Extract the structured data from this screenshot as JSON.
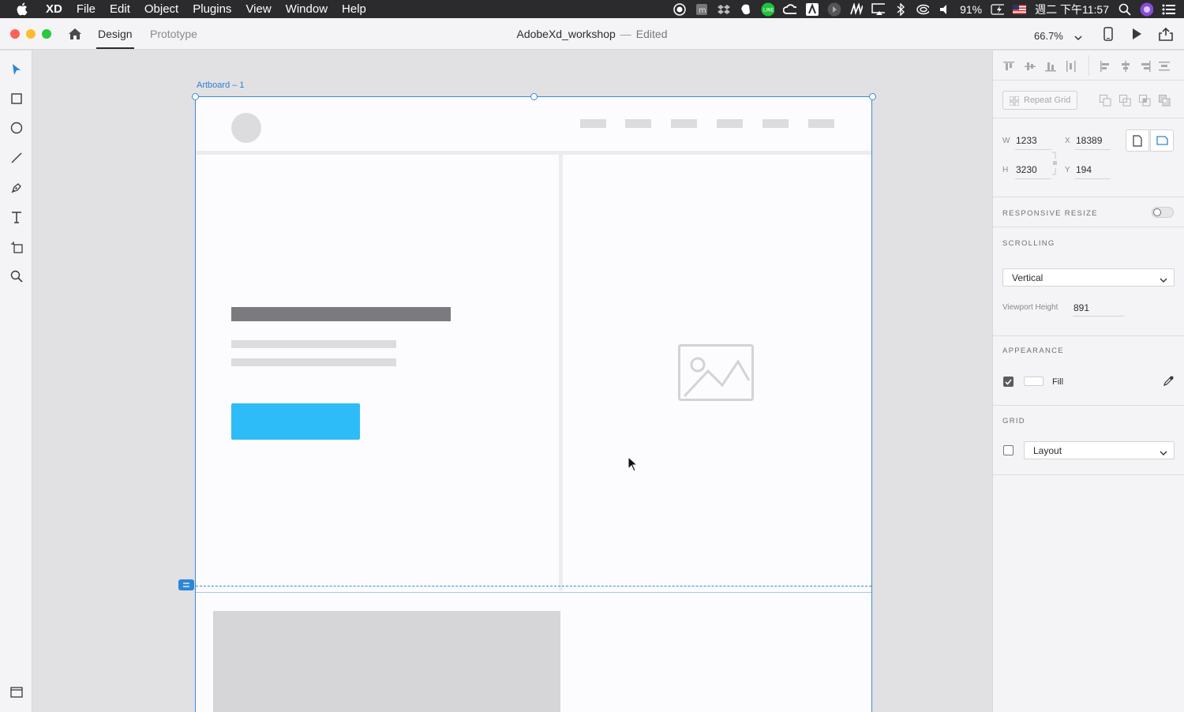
{
  "menubar": {
    "app": "XD",
    "items": [
      "File",
      "Edit",
      "Object",
      "Plugins",
      "View",
      "Window",
      "Help"
    ],
    "battery": "91%",
    "clock": "週二 下午11:57"
  },
  "toolbar": {
    "tab_design": "Design",
    "tab_prototype": "Prototype",
    "doc_name": "AdobeXd_workshop",
    "separator": "—",
    "doc_status": "Edited",
    "zoom": "66.7%"
  },
  "canvas": {
    "artboard_label": "Artboard – 1"
  },
  "panel": {
    "repeat_grid": "Repeat Grid",
    "w_label": "W",
    "w_value": "1233",
    "h_label": "H",
    "h_value": "3230",
    "x_label": "X",
    "x_value": "18389",
    "y_label": "Y",
    "y_value": "194",
    "responsive_resize": "RESPONSIVE RESIZE",
    "scrolling": "SCROLLING",
    "scrolling_value": "Vertical",
    "viewport_label": "Viewport Height",
    "viewport_value": "891",
    "appearance": "APPEARANCE",
    "fill_label": "Fill",
    "fill_checked": true,
    "grid": "GRID",
    "grid_value": "Layout",
    "grid_checked": false
  },
  "colors": {
    "accent": "#3b8bd6",
    "cta": "#2dbcf7",
    "headline": "#7b7a7e"
  }
}
